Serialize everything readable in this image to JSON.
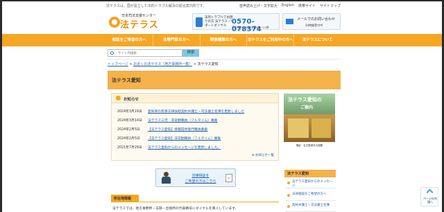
{
  "header": {
    "tagline": "法テラスは、国が設立した法的トラブル解決の総合案内所です。",
    "top_links": [
      "音声読み上げ・文字拡大",
      "English",
      "携帯サイト",
      "サイトマップ"
    ],
    "logo_org": "日本司法支援センター",
    "logo_name": "法テラス",
    "phone": {
      "label": "法的トラブルでお困りの方 法テラス・サポートダイヤル",
      "number": "0570-078374",
      "hours": "平日9時～21時 土曜9時～17時"
    },
    "mail": {
      "label": "メールでのお問い合わせ",
      "sub": "24時間受付中"
    }
  },
  "nav": {
    "items": [
      "相談をご希望の方へ",
      "法専門家の方へ",
      "関係機関の方へ",
      "法テラスをご利用中の方へ",
      "法テラスについて"
    ]
  },
  "search": {
    "placeholder": "サイト内検索",
    "button": "検索"
  },
  "breadcrumb": {
    "home": "トップページ",
    "sep": ">",
    "parent": "お近くの法テラス（地方事務所一覧）",
    "current": "法テラス愛知"
  },
  "page_title": "法テラス愛知",
  "news": {
    "title": "お知らせ",
    "items": [
      {
        "date": "2024年3月19日",
        "text": "愛知県の民事法律扶助契約弁護士・司法書士名簿を更新しました"
      },
      {
        "date": "2024年3月14日",
        "text": "法テラス三河　非常勤職員（フルタイム）募集"
      },
      {
        "date": "2024年2月5日",
        "text": "【法テラス愛知】情報提供専門職員募集"
      },
      {
        "date": "2024年2月5日",
        "text": "【法テラス愛知】非常勤職員（フルタイム）募集"
      },
      {
        "date": "2021年7月29日",
        "text": "法テラス愛知からのメッセージを更新しました。"
      }
    ],
    "more": "お知らせ一覧"
  },
  "promo": {
    "title1": "法テラス愛知の",
    "title2": "ご案内",
    "caption": "撮影　名古屋城本丸御殿"
  },
  "consult": {
    "line1": "法律相談を",
    "line2": "ご希望の方はこちら",
    "arrow": "›"
  },
  "location": {
    "title": "所在地情報",
    "text": "法テラスでは、地方事務所・支部・出張所の代表番号にダイヤルを導入しています。"
  },
  "sidebar": {
    "title": "法テラス愛知",
    "items": [
      "法テラス愛知からのメッセージ",
      "法律相談をご希望の方へ",
      "契約弁護士・司法書士名簿"
    ]
  },
  "pagetop": {
    "label": "ページの先頭へ"
  },
  "colors": {
    "accent": "#f5a623",
    "link": "#1a5fb4",
    "phone": "#1a6fc4"
  }
}
